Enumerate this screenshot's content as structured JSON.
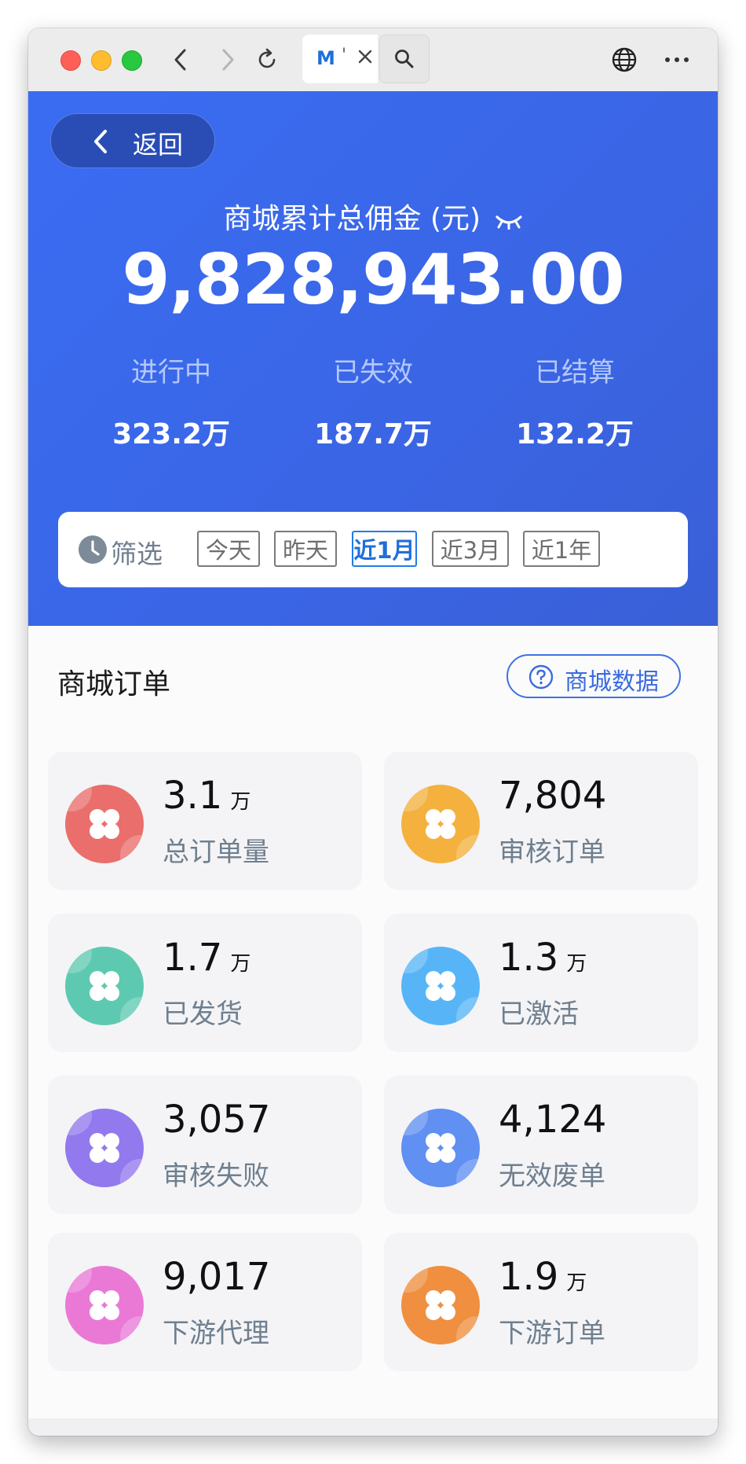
{
  "browser": {
    "tab_logo_text": "M",
    "tab_title": "'"
  },
  "header": {
    "back_label": "返回",
    "title": "商城累计总佣金 (元)",
    "total": "9,828,943.00",
    "stats": [
      {
        "label": "进行中",
        "value": "323.2万"
      },
      {
        "label": "已失效",
        "value": "187.7万"
      },
      {
        "label": "已结算",
        "value": "132.2万"
      }
    ]
  },
  "filter": {
    "label": "筛选",
    "options": [
      "今天",
      "昨天",
      "近1月",
      "近3月",
      "近1年"
    ],
    "selected": "近1月"
  },
  "orders": {
    "title": "商城订单",
    "data_button": "商城数据",
    "cards": [
      {
        "value": "3.1",
        "unit": "万",
        "label": "总订单量",
        "color": "#ea6e6b"
      },
      {
        "value": "7,804",
        "unit": "",
        "label": "审核订单",
        "color": "#f4b13e"
      },
      {
        "value": "1.7",
        "unit": "万",
        "label": "已发货",
        "color": "#5ec9b1"
      },
      {
        "value": "1.3",
        "unit": "万",
        "label": "已激活",
        "color": "#57b5f7"
      },
      {
        "value": "3,057",
        "unit": "",
        "label": "审核失败",
        "color": "#9379ee"
      },
      {
        "value": "4,124",
        "unit": "",
        "label": "无效废单",
        "color": "#5f90f2"
      },
      {
        "value": "9,017",
        "unit": "",
        "label": "下游代理",
        "color": "#ea79d6"
      },
      {
        "value": "1.9",
        "unit": "万",
        "label": "下游订单",
        "color": "#ef8f3f"
      }
    ]
  },
  "colors": {
    "hero_start": "#3a6cf2",
    "hero_end": "#3a5fd7",
    "accent": "#1f7ce8"
  }
}
